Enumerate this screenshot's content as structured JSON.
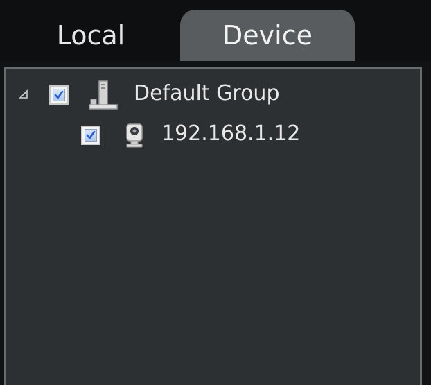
{
  "tabs": [
    {
      "label": "Local",
      "active": false
    },
    {
      "label": "Device",
      "active": true
    }
  ],
  "tree": {
    "group": {
      "label": "Default Group",
      "checked": true,
      "expanded": true,
      "icon": "server-group-icon"
    },
    "devices": [
      {
        "label": "192.168.1.12",
        "checked": true,
        "icon": "camera-icon"
      }
    ]
  },
  "colors": {
    "background": "#0e0f10",
    "panel": "#2d3033",
    "active_tab": "#595c5f",
    "text": "#e8e8e8",
    "check": "#2a5bd7"
  }
}
